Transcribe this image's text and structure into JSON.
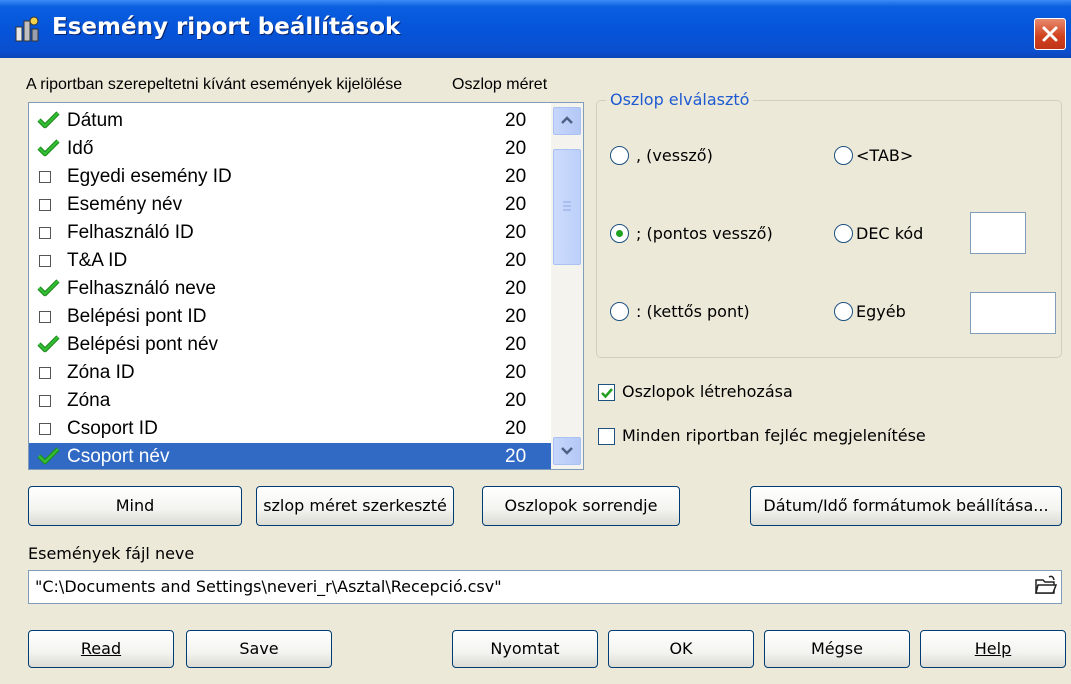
{
  "window": {
    "title": "Esemény riport beállítások",
    "icon": "report-app-icon"
  },
  "list": {
    "header_label": "A riportban szerepeltetni kívánt események kijelölése",
    "size_header": "Oszlop méret",
    "items": [
      {
        "name": "Dátum",
        "size": "20",
        "checked": true
      },
      {
        "name": "Idő",
        "size": "20",
        "checked": true
      },
      {
        "name": "Egyedi esemény ID",
        "size": "20",
        "checked": false
      },
      {
        "name": "Esemény név",
        "size": "20",
        "checked": false
      },
      {
        "name": "Felhasználó ID",
        "size": "20",
        "checked": false
      },
      {
        "name": "T&A ID",
        "size": "20",
        "checked": false
      },
      {
        "name": "Felhasználó neve",
        "size": "20",
        "checked": true
      },
      {
        "name": "Belépési pont ID",
        "size": "20",
        "checked": false
      },
      {
        "name": "Belépési pont név",
        "size": "20",
        "checked": true
      },
      {
        "name": "Zóna ID",
        "size": "20",
        "checked": false
      },
      {
        "name": "Zóna",
        "size": "20",
        "checked": false
      },
      {
        "name": "Csoport ID",
        "size": "20",
        "checked": false
      },
      {
        "name": "Csoport név",
        "size": "20",
        "checked": true,
        "selected": true
      }
    ]
  },
  "separator": {
    "title": "Oszlop elválasztó",
    "options": {
      "comma": ", (vessző)",
      "tab": "<TAB>",
      "semicolon": "; (pontos vessző)",
      "dec": "DEC kód",
      "colon": ": (kettős pont)",
      "other": "Egyéb"
    },
    "selected": "semicolon",
    "dec_value": "",
    "other_value": ""
  },
  "checkboxes": {
    "create_columns": {
      "label": "Oszlopok létrehozása",
      "checked": true
    },
    "header_every_report": {
      "label": "Minden riportban fejléc megjelenítése",
      "checked": false
    }
  },
  "buttons": {
    "all": "Mind",
    "edit_size": "szlop méret szerkeszté",
    "column_order": "Oszlopok sorrendje",
    "datetime_format": "Dátum/Idő formátumok beállítása...",
    "read": "Read",
    "save": "Save",
    "print": "Nyomtat",
    "ok": "OK",
    "cancel": "Mégse",
    "help": "Help"
  },
  "file": {
    "label": "Események fájl neve",
    "value": "\"C:\\Documents and Settings\\neveri_r\\Asztal\\Recepció.csv\""
  },
  "colors": {
    "title_blue": "#0554d9",
    "selection": "#316ac5",
    "check_green": "#21a121",
    "group_title": "#1d5ad2"
  }
}
